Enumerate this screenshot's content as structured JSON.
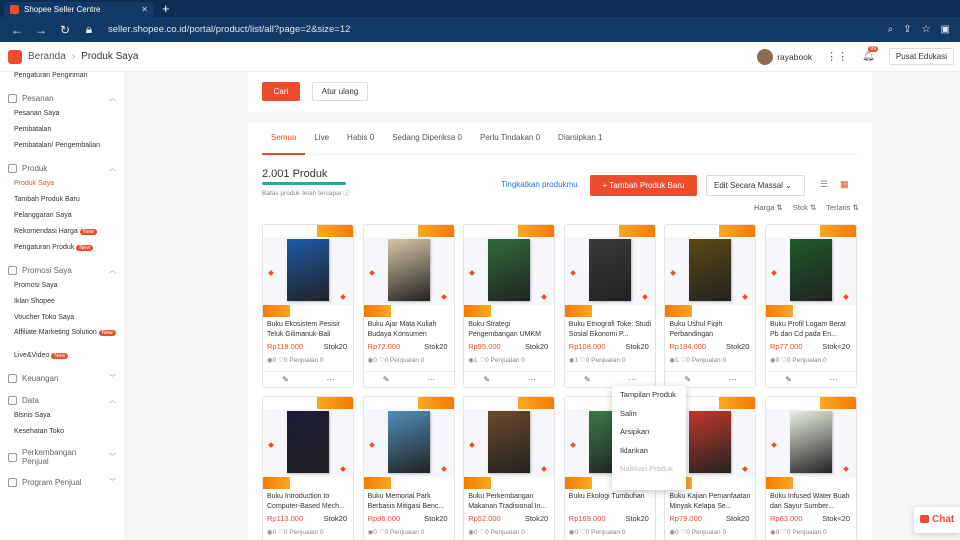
{
  "browser": {
    "tab_title": "Shopee Seller Centre",
    "url": "seller.shopee.co.id/portal/product/list/all?page=2&size=12"
  },
  "header": {
    "breadcrumb_home": "Beranda",
    "breadcrumb_current": "Produk Saya",
    "user": "rayabook",
    "notif_count": "99",
    "edu_button": "Pusat Edukasi"
  },
  "sidebar": {
    "top_item": "Pengaturan Pengiriman",
    "groups": [
      {
        "title": "Pesanan",
        "items": [
          "Pesanan Saya",
          "Pembatalan",
          "Pembatalan/ Pengembalian"
        ]
      },
      {
        "title": "Produk",
        "items": [
          "Produk Saya",
          "Tambah Produk Baru",
          "Pelanggaran Saya",
          "Rekomendasi Harga",
          "Pengaturan Produk"
        ]
      },
      {
        "title": "Promosi Saya",
        "items": [
          "Promosi Saya",
          "Iklan Shopee",
          "Voucher Toko Saya",
          "Affiliate Marketing Solution",
          "Live&Video"
        ]
      },
      {
        "title": "Keuangan",
        "items": []
      },
      {
        "title": "Data",
        "items": [
          "Bisnis Saya",
          "Kesehatan Toko"
        ]
      },
      {
        "title": "Perkembangan Penjual",
        "items": []
      },
      {
        "title": "Program Penjual",
        "items": []
      }
    ],
    "new_badge": "New"
  },
  "search": {
    "search_button": "Cari",
    "reset_button": "Atur ulang"
  },
  "tabs": [
    "Semua",
    "Live",
    "Habis 0",
    "Sedang Diperiksa 0",
    "Perlu Tindakan 0",
    "Diarsipkan 1"
  ],
  "summary": {
    "count": "2.001 Produk",
    "limit_text": "Batas produk telah tercapai",
    "upgrade_link": "Tingkatkan produkmu",
    "add_button": "Tambah Produk Baru",
    "bulk_edit": "Edit Secara Massal",
    "sort_price": "Harga",
    "sort_stock": "Stok",
    "sort_sold": "Terlaris"
  },
  "products": [
    {
      "name": "Buku Ekosistem Pesisir Teluk Gilimanuk-Bali",
      "price": "Rp119.000",
      "stock": "Stok20",
      "stats": "◉0  ♡0  Penjualan 0",
      "cover": "#1b5aa8",
      "title": "Ekosistem Pesisir"
    },
    {
      "name": "Buku Ajar Mata Kuliah Budaya Konsumen",
      "price": "Rp72.000",
      "stock": "Stok20",
      "stats": "◉0  ♡0  Penjualan 0",
      "cover": "#d8c7a8",
      "title": "Budaya Konsumen"
    },
    {
      "name": "Buku Strategi Pengembangan UMKM",
      "price": "Rp95.000",
      "stock": "Stok20",
      "stats": "◉1  ♡0  Penjualan 0",
      "cover": "#2f6b3a",
      "title": "Pengembangan UMKM"
    },
    {
      "name": "Buku Etnografi Toke: Studi Sosial Ekonomi P...",
      "price": "Rp108.000",
      "stock": "Stok20",
      "stats": "◉1  ♡0  Penjualan 0",
      "cover": "#3a3a3a",
      "title": "Etnografi TOKE"
    },
    {
      "name": "Buku Ushul Fiqih Perbandingan",
      "price": "Rp184.000",
      "stock": "Stok20",
      "stats": "◉1  ♡0  Penjualan 0",
      "cover": "#5a4a12",
      "title": "Ushul Fiqih"
    },
    {
      "name": "Buku Profil Logam Berat Pb dan Cd pada En...",
      "price": "Rp77.000",
      "stock": "Stok<20",
      "stats": "◉0  ♡0  Penjualan 0",
      "cover": "#1e5a2a",
      "title": ""
    },
    {
      "name": "Buku Introduction to Computer-Based Mech...",
      "price": "Rp113.000",
      "stock": "Stok20",
      "stats": "◉0  ♡0  Penjualan 0",
      "cover": "#1c1c3a",
      "title": "3D"
    },
    {
      "name": "Buku Memorial Park Berbasis Mitigasi Benc...",
      "price": "Rp96.000",
      "stock": "Stok20",
      "stats": "◉0  ♡0  Penjualan 0",
      "cover": "#4f8fb8",
      "title": "Memorial Park"
    },
    {
      "name": "Buku Perkembangan Makanan Tradisional In...",
      "price": "Rp52.000",
      "stock": "Stok20",
      "stats": "◉0  ♡0  Penjualan 0",
      "cover": "#6b4a2a",
      "title": ""
    },
    {
      "name": "Buku Ekologi Tumbuhan",
      "price": "Rp169.000",
      "stock": "Stok20",
      "stats": "◉0  ♡0  Penjualan 0",
      "cover": "#3a7a4a",
      "title": "Ekologi"
    },
    {
      "name": "Buku Kajian Pemanfaatan Minyak Kelapa Se...",
      "price": "Rp79.000",
      "stock": "Stok20",
      "stats": "◉0  ♡0  Penjualan 0",
      "cover": "#c0392b",
      "title": ""
    },
    {
      "name": "Buku Infused Water Buah dan Sayur Sumber...",
      "price": "Rp63.000",
      "stock": "Stok<20",
      "stats": "◉0  ♡0  Penjualan 0",
      "cover": "#e9f0e2",
      "title": "Infused Water"
    }
  ],
  "menu": [
    "Tampilan Produk",
    "Salin",
    "Arsipkan",
    "Iklankan",
    "Naikkan Produk"
  ],
  "chat": "Chat"
}
